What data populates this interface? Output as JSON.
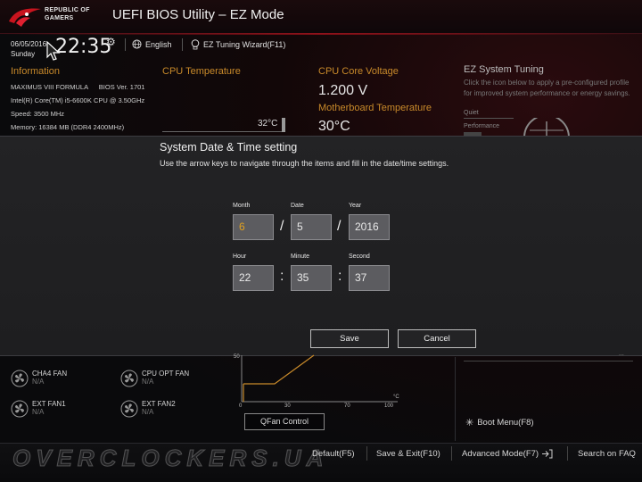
{
  "header": {
    "brand_line1": "REPUBLIC OF",
    "brand_line2": "GAMERS",
    "title": "UEFI BIOS Utility – EZ Mode"
  },
  "subheader": {
    "date": "06/05/2016",
    "day": "Sunday",
    "time": "22:35",
    "language": "English",
    "wizard": "EZ Tuning Wizard(F11)"
  },
  "information": {
    "title": "Information",
    "board": "MAXIMUS VIII FORMULA",
    "bios": "BIOS Ver. 1701",
    "cpu": "Intel(R) Core(TM) i5-6600K CPU @ 3.50GHz",
    "speed": "Speed: 3500 MHz",
    "memory": "Memory: 16384 MB (DDR4 2400MHz)"
  },
  "cpu_temp": {
    "title": "CPU Temperature",
    "value": "32°C"
  },
  "voltage": {
    "title": "CPU Core Voltage",
    "value": "1.200 V",
    "mb_temp_title": "Motherboard Temperature",
    "mb_temp_value": "30°C"
  },
  "ez_tuning": {
    "title": "EZ System Tuning",
    "desc": "Click the icon below to apply a pre-configured profile for improved system performance or energy savings.",
    "opt1": "Quiet",
    "opt2": "Performance"
  },
  "fans": [
    {
      "name": "CHA4 FAN",
      "value": "N/A"
    },
    {
      "name": "CPU OPT FAN",
      "value": "N/A"
    },
    {
      "name": "EXT FAN1",
      "value": "N/A"
    },
    {
      "name": "EXT FAN2",
      "value": "N/A"
    }
  ],
  "fan_chart": {
    "y_label": "50",
    "x_ticks": [
      "0",
      "30",
      "70",
      "100"
    ],
    "x_unit": "°C",
    "button": "QFan Control"
  },
  "boot_menu": "Boot Menu(F8)",
  "footer": {
    "default": "Default(F5)",
    "save_exit": "Save & Exit(F10)",
    "advanced": "Advanced Mode(F7)",
    "search": "Search on FAQ",
    "watermark": "OVERCLOCKERS.UA"
  },
  "dialog": {
    "title": "System Date & Time setting",
    "desc": "Use the arrow keys to navigate through the items and fill in the date/time settings.",
    "month_label": "Month",
    "month": "6",
    "date_label": "Date",
    "date": "5",
    "year_label": "Year",
    "year": "2016",
    "hour_label": "Hour",
    "hour": "22",
    "minute_label": "Minute",
    "minute": "35",
    "second_label": "Second",
    "second": "37",
    "date_sep": "/",
    "time_sep": ":",
    "save": "Save",
    "cancel": "Cancel"
  },
  "colors": {
    "accent": "#c98a2a",
    "active_field": "#e0a020",
    "brand_red": "#c8141e"
  }
}
